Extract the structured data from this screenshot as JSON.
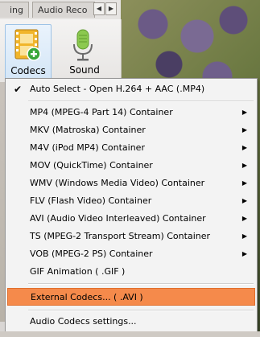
{
  "tabs": [
    {
      "label": "ing"
    },
    {
      "label": "Audio Reco"
    }
  ],
  "tab_scroll": {
    "left": "◀",
    "right": "▶"
  },
  "toolbar": {
    "codecs_label": "Codecs",
    "sound_label": "Sound"
  },
  "menu": {
    "items": [
      {
        "label": "Auto Select - Open H.264 + AAC (.MP4)",
        "checked": true,
        "submenu": false
      },
      {
        "label": "MP4 (MPEG-4 Part 14) Container",
        "submenu": true
      },
      {
        "label": "MKV (Matroska) Container",
        "submenu": true
      },
      {
        "label": "M4V (iPod MP4) Container",
        "submenu": true
      },
      {
        "label": "MOV (QuickTime) Container",
        "submenu": true
      },
      {
        "label": "WMV (Windows Media Video) Container",
        "submenu": true
      },
      {
        "label": "FLV (Flash Video) Container",
        "submenu": true
      },
      {
        "label": "AVI (Audio Video Interleaved) Container",
        "submenu": true
      },
      {
        "label": "TS (MPEG-2 Transport Stream) Container",
        "submenu": true
      },
      {
        "label": "VOB (MPEG-2 PS) Container",
        "submenu": true
      },
      {
        "label": "GIF Animation ( .GIF )",
        "submenu": false
      },
      {
        "label": "External Codecs... ( .AVI )",
        "submenu": false,
        "highlighted": true
      },
      {
        "label": "Audio Codecs settings...",
        "submenu": false
      }
    ],
    "check_glyph": "✔",
    "arrow_glyph": "▶"
  },
  "colors": {
    "highlight": "#f58a4b",
    "menu_bg": "#f3f3f3"
  }
}
